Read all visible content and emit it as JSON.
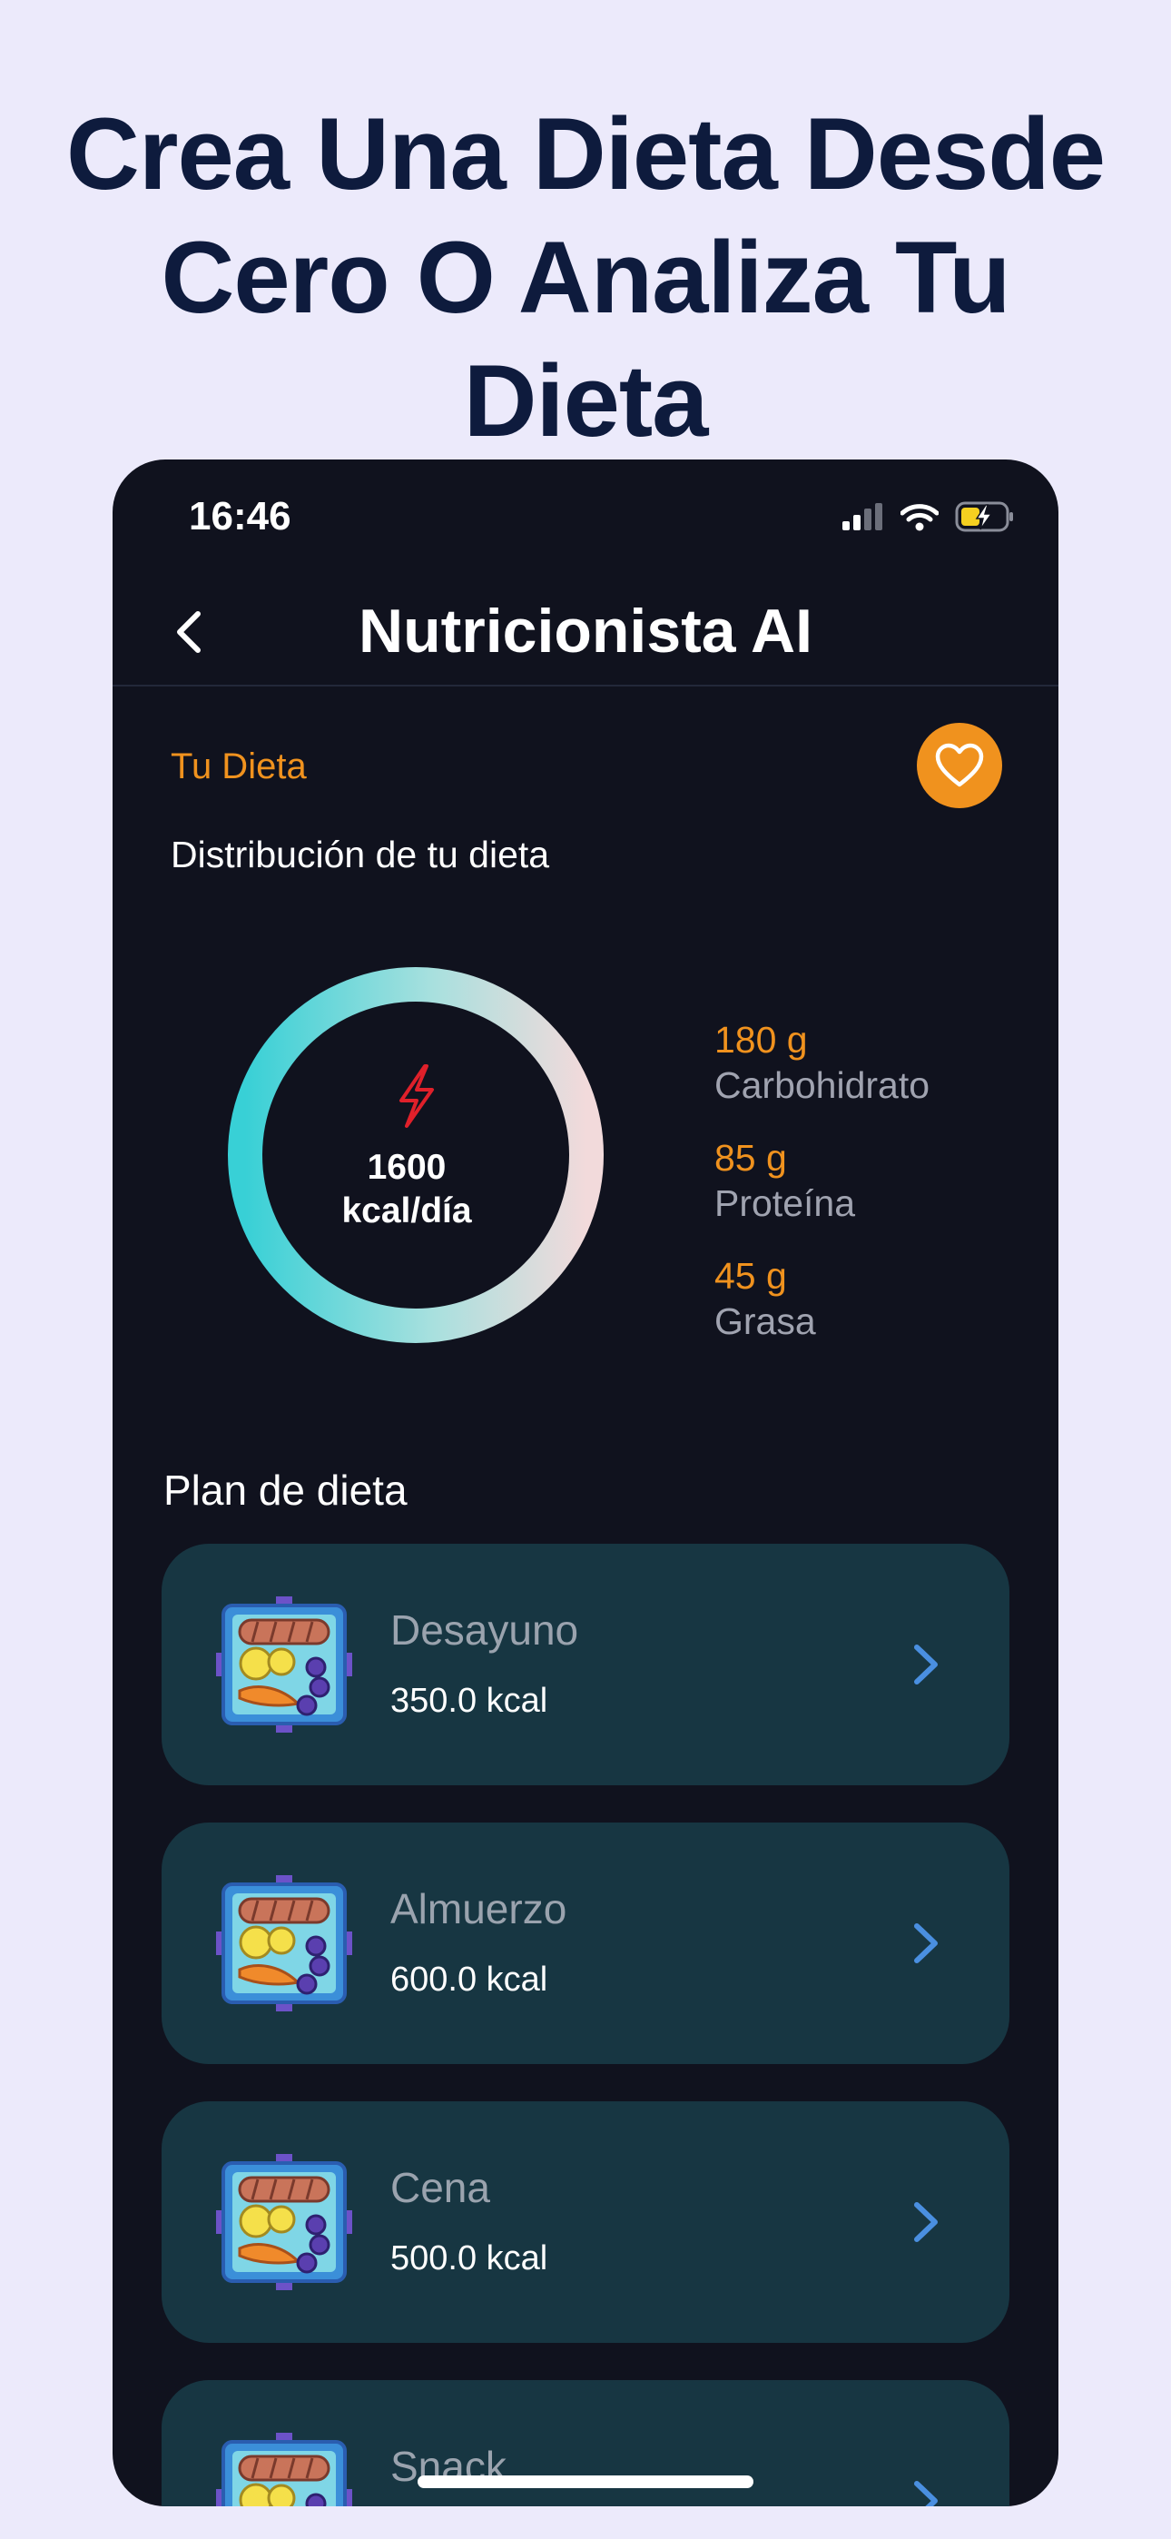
{
  "headline": "Crea Una Dieta Desde Cero O Analiza Tu Dieta",
  "status": {
    "time": "16:46"
  },
  "nav": {
    "title": "Nutricionista AI"
  },
  "diet": {
    "section_label": "Tu Dieta",
    "distribution_label": "Distribución de tu dieta",
    "kcal_value": "1600",
    "kcal_unit": "kcal/día",
    "macros": [
      {
        "value": "180 g",
        "name": "Carbohidrato"
      },
      {
        "value": "85 g",
        "name": "Proteína"
      },
      {
        "value": "45 g",
        "name": "Grasa"
      }
    ]
  },
  "plan": {
    "label": "Plan de dieta",
    "meals": [
      {
        "name": "Desayuno",
        "kcal": "350.0 kcal"
      },
      {
        "name": "Almuerzo",
        "kcal": "600.0 kcal"
      },
      {
        "name": "Cena",
        "kcal": "500.0 kcal"
      },
      {
        "name": "Snack",
        "kcal": ""
      }
    ]
  },
  "colors": {
    "accent": "#F0921E",
    "background": "#10121E",
    "card": "#173642",
    "page": "#ECEAFB"
  }
}
